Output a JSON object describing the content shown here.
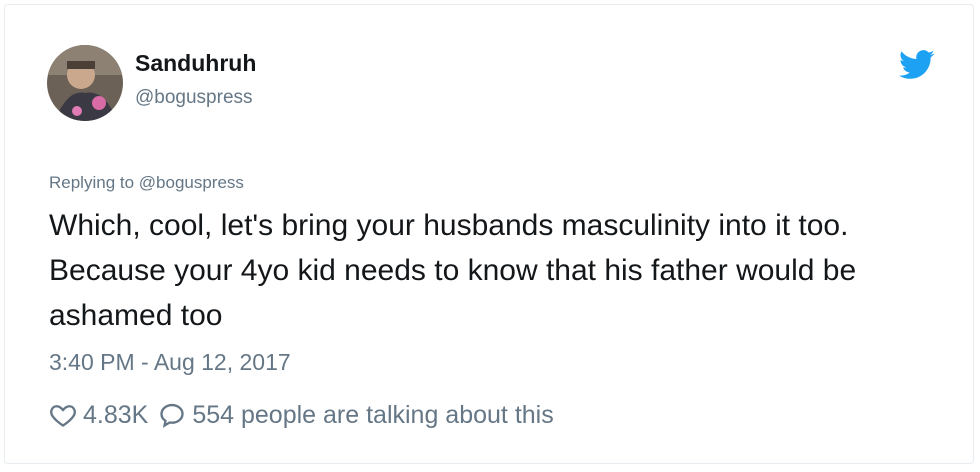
{
  "author": {
    "display_name": "Sanduhruh",
    "handle": "@boguspress",
    "avatar_icon": "user-avatar"
  },
  "brand": {
    "icon": "twitter-bird-icon",
    "color": "#1da1f2"
  },
  "tweet": {
    "replying_to": "Replying to @boguspress",
    "text": "Which, cool, let's bring your husbands masculinity into it too. Because your 4yo kid needs to know that his father would be ashamed too",
    "timestamp": "3:40 PM - Aug 12, 2017"
  },
  "actions": {
    "like_icon": "heart-icon",
    "like_count": "4.83K",
    "reply_icon": "speech-bubble-icon",
    "talking_text": "554 people are talking about this"
  },
  "colors": {
    "text_primary": "#14171a",
    "text_secondary": "#657786",
    "border": "#e6ecf0"
  }
}
